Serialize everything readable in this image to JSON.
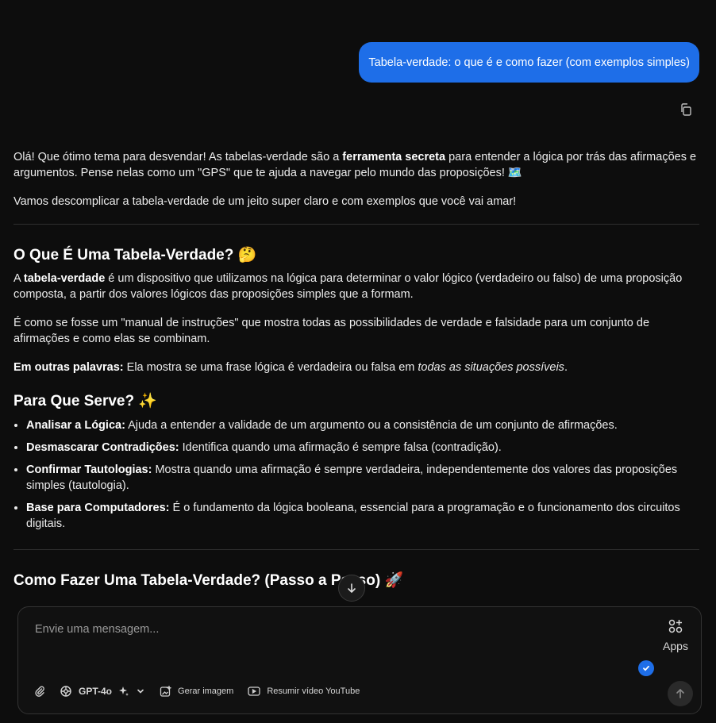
{
  "user_message": "Tabela-verdade: o que é e como fazer (com exemplos simples)",
  "answer": {
    "intro_1_a": "Olá! Que ótimo tema para desvendar! As tabelas-verdade são a ",
    "intro_1_b": "ferramenta secreta",
    "intro_1_c": " para entender a lógica por trás das afirmações e argumentos. Pense nelas como um \"GPS\" que te ajuda a navegar pelo mundo das proposições! ",
    "intro_1_emoji": "🗺️",
    "intro_2": "Vamos descomplicar a tabela-verdade de um jeito super claro e com exemplos que você vai amar!",
    "h_what": "O Que É Uma Tabela-Verdade?",
    "h_what_emoji": "🤔",
    "what_p1_a": "A ",
    "what_p1_b": "tabela-verdade",
    "what_p1_c": " é um dispositivo que utilizamos na lógica para determinar o valor lógico (verdadeiro ou falso) de uma proposição composta, a partir dos valores lógicos das proposições simples que a formam.",
    "what_p2": "É como se fosse um \"manual de instruções\" que mostra todas as possibilidades de verdade e falsidade para um conjunto de afirmações e como elas se combinam.",
    "what_p3_a": "Em outras palavras:",
    "what_p3_b": " Ela mostra se uma frase lógica é verdadeira ou falsa em ",
    "what_p3_c": "todas as situações possíveis",
    "what_p3_d": ".",
    "h_use": "Para Que Serve?",
    "h_use_emoji": "✨",
    "uses": [
      {
        "title": "Analisar a Lógica:",
        "text": " Ajuda a entender a validade de um argumento ou a consistência de um conjunto de afirmações."
      },
      {
        "title": "Desmascarar Contradições:",
        "text": " Identifica quando uma afirmação é sempre falsa (contradição)."
      },
      {
        "title": "Confirmar Tautologias:",
        "text": " Mostra quando uma afirmação é sempre verdadeira, independentemente dos valores das proposições simples (tautologia)."
      },
      {
        "title": "Base para Computadores:",
        "text": " É o fundamento da lógica booleana, essencial para a programação e o funcionamento dos circuitos digitais."
      }
    ],
    "h_how": "Como Fazer Uma Tabela-Verdade? (Passo a Passo)",
    "h_how_emoji": "🚀"
  },
  "composer": {
    "placeholder": "Envie uma mensagem...",
    "apps_label": "Apps",
    "model_label": "GPT-4o",
    "image_label": "Gerar imagem",
    "youtube_label": "Resumir vídeo YouTube"
  },
  "icons": [
    "copy-icon",
    "arrow-down-icon",
    "apps-icon",
    "check-icon",
    "paperclip-icon",
    "model-icon",
    "sparkle-icon",
    "chevron-down-icon",
    "image-gen-icon",
    "youtube-icon",
    "arrow-up-icon"
  ],
  "colors": {
    "accent": "#1e6ee8",
    "background": "#0d0d0d"
  }
}
